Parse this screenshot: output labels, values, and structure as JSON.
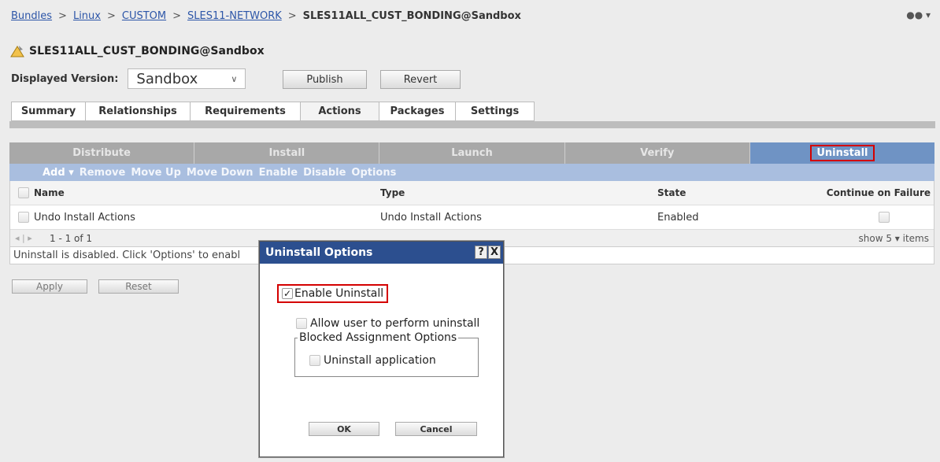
{
  "breadcrumb": {
    "items": [
      "Bundles",
      "Linux",
      "CUSTOM",
      "SLES11-NETWORK"
    ],
    "separator": ">",
    "current": "SLES11ALL_CUST_BONDING@Sandbox"
  },
  "top_right": {
    "label": "●● ▾"
  },
  "title": "SLES11ALL_CUST_BONDING@Sandbox",
  "version": {
    "label": "Displayed Version:",
    "selected": "Sandbox"
  },
  "buttons": {
    "publish": "Publish",
    "revert": "Revert",
    "apply": "Apply",
    "reset": "Reset"
  },
  "tabs": [
    "Summary",
    "Relationships",
    "Requirements",
    "Actions",
    "Packages",
    "Settings"
  ],
  "active_tab": "Actions",
  "action_tabs": [
    "Distribute",
    "Install",
    "Launch",
    "Verify",
    "Uninstall"
  ],
  "active_action_tab": "Uninstall",
  "toolbar": {
    "add": "Add ▾",
    "items": [
      "Remove",
      "Move Up",
      "Move Down",
      "Enable",
      "Disable",
      "Options"
    ]
  },
  "grid": {
    "columns": {
      "name": "Name",
      "type": "Type",
      "state": "State",
      "continue": "Continue on Failure"
    },
    "rows": [
      {
        "name": "Undo Install Actions",
        "type": "Undo Install Actions",
        "state": "Enabled"
      }
    ],
    "pager": {
      "nav": "◂ | ▸",
      "range": "1 - 1 of 1",
      "show": "show 5 ▾ items"
    },
    "status": "Uninstall is disabled. Click 'Options' to enabl"
  },
  "dialog": {
    "title": "Uninstall Options",
    "help": "?",
    "close": "X",
    "enable_uninstall": "Enable Uninstall",
    "allow_user": "Allow user to perform uninstall",
    "blocked_legend": "Blocked Assignment Options",
    "uninstall_app": "Uninstall application",
    "ok": "OK",
    "cancel": "Cancel"
  },
  "colors": {
    "accent": "#2c4f8f",
    "action_active": "#6f93c4",
    "toolbar": "#a9bedf",
    "highlight": "#d40000",
    "link": "#2d56a8"
  }
}
